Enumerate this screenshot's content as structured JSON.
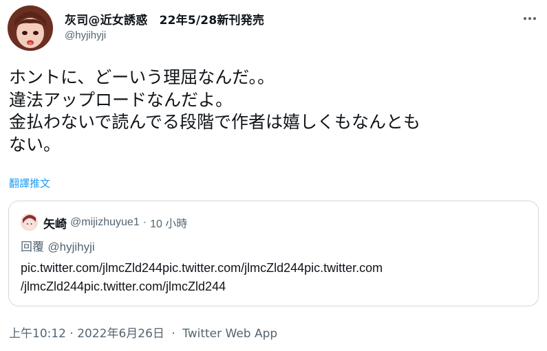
{
  "author": {
    "display_name": "灰司@近女誘惑　22年5/28新刊発売",
    "handle": "@hyjihyji"
  },
  "tweet": {
    "lines": [
      "ホントに、どーいう理屈なんだ。。",
      "違法アップロードなんだよ。",
      "金払わないで読んでる段階で作者は嬉しくもなんとも",
      "ない。"
    ],
    "translate_label": "翻譯推文"
  },
  "quoted_tweet": {
    "name": "矢崎",
    "handle": "@mijizhuyue1",
    "time": "10 小時",
    "reply_prefix": "回覆",
    "reply_handle": "@hyjihyji",
    "body_lines": [
      "pic.twitter.com/jlmcZld244pic.twitter.com/jlmcZld244pic.twitter.com",
      "/jlmcZld244pic.twitter.com/jlmcZld244"
    ]
  },
  "footer": {
    "timestamp": "上午10:12 · 2022年6月26日",
    "source": "Twitter Web App"
  },
  "icons": {
    "more": "more-horizontal-icon"
  },
  "colors": {
    "link": "#1d9bf0",
    "secondary_text": "#536471",
    "border": "#cfd9de"
  }
}
